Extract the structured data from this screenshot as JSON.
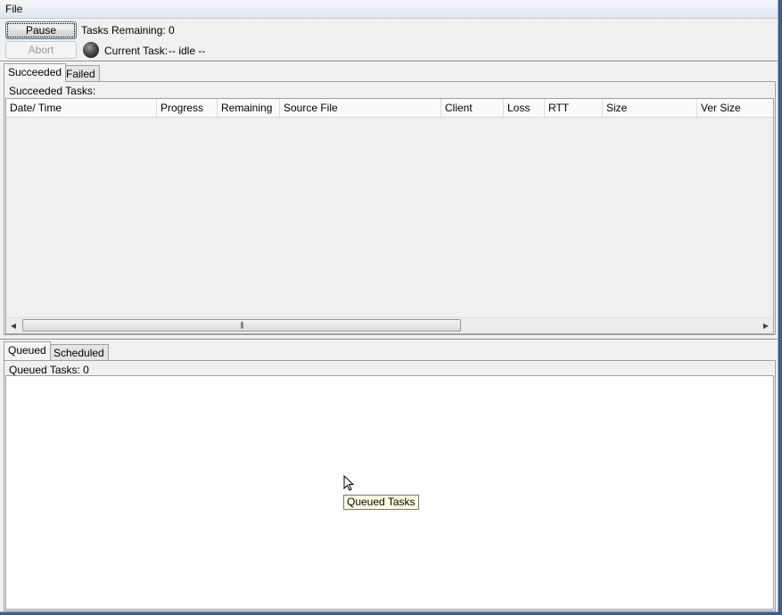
{
  "menubar": {
    "items": [
      {
        "label": "File"
      }
    ]
  },
  "toolbar": {
    "pause_label": "Pause",
    "abort_label": "Abort",
    "tasks_remaining_label": "Tasks Remaining: 0",
    "current_task_label": "Current Task:",
    "current_task_value": "-- idle --"
  },
  "results": {
    "tabs": [
      {
        "label": "Succeeded",
        "active": true
      },
      {
        "label": "Failed",
        "active": false
      }
    ],
    "panel_title": "Succeeded Tasks:",
    "columns": [
      "Date/ Time",
      "Progress",
      "Remaining",
      "Source File",
      "Client",
      "Loss",
      "RTT",
      "Size",
      "Ver Size"
    ],
    "rows": []
  },
  "queue": {
    "tabs": [
      {
        "label": "Queued",
        "active": true
      },
      {
        "label": "Scheduled",
        "active": false
      }
    ],
    "panel_title": "Queued Tasks: 0",
    "tooltip": "Queued Tasks"
  },
  "icons": {
    "status": "status-ball-icon",
    "cursor": "mouse-pointer-icon",
    "scroll_left": "chevron-left-icon",
    "scroll_right": "chevron-right-icon",
    "scroll_grip": "grip-icon"
  }
}
